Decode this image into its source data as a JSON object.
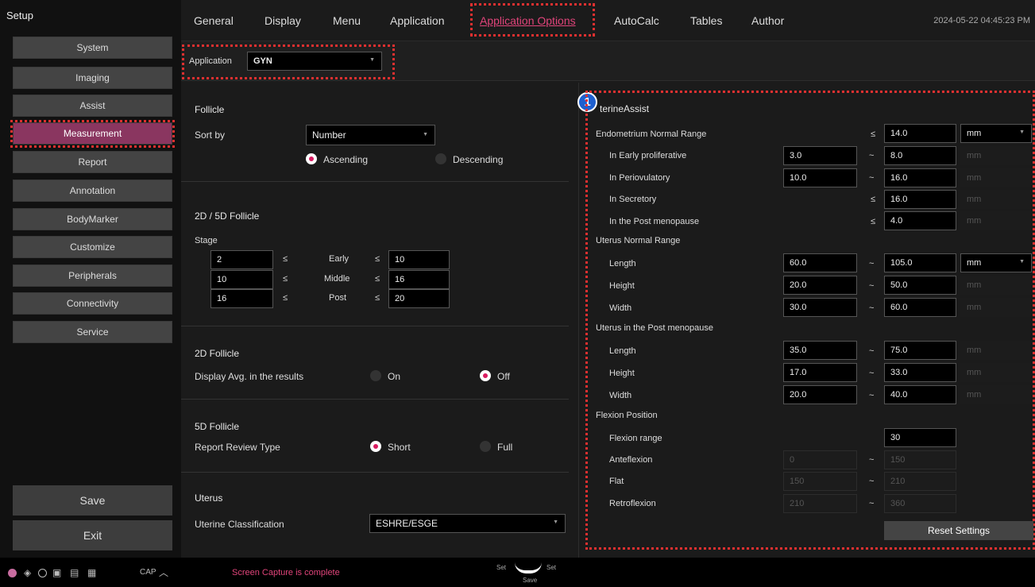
{
  "sidebar": {
    "title": "Setup",
    "items": [
      "System",
      "Imaging",
      "Assist",
      "Measurement",
      "Report",
      "Annotation",
      "BodyMarker",
      "Customize",
      "Peripherals",
      "Connectivity",
      "Service"
    ],
    "save": "Save",
    "exit": "Exit"
  },
  "tabs": [
    "General",
    "Display",
    "Menu",
    "Application",
    "Application Options",
    "AutoCalc",
    "Tables",
    "Author"
  ],
  "datetime": "2024-05-22 04:45:23 PM",
  "appbar": {
    "label": "Application",
    "value": "GYN"
  },
  "follicle": {
    "title": "Follicle",
    "sort_label": "Sort by",
    "sort_value": "Number",
    "asc": "Ascending",
    "desc": "Descending"
  },
  "follicle2d5d": {
    "title": "2D / 5D Follicle",
    "stage": "Stage",
    "rows": [
      {
        "from": "2",
        "name": "Early",
        "to": "10"
      },
      {
        "from": "10",
        "name": "Middle",
        "to": "16"
      },
      {
        "from": "16",
        "name": "Post",
        "to": "20"
      }
    ],
    "le": "≤"
  },
  "follicle2d": {
    "title": "2D Follicle",
    "label": "Display Avg. in the results",
    "on": "On",
    "off": "Off"
  },
  "follicle5d": {
    "title": "5D Follicle",
    "label": "Report Review Type",
    "short": "Short",
    "full": "Full"
  },
  "uterus": {
    "title": "Uterus",
    "label": "Uterine Classification",
    "value": "ESHRE/ESGE"
  },
  "uterine": {
    "title": "terineAssist",
    "badge": "1",
    "endo_title": "Endometrium Normal Range",
    "endo_max": "14.0",
    "unit": "mm",
    "endo_rows": [
      {
        "label": "In Early proliferative",
        "a": "3.0",
        "b": "8.0",
        "sym": "~"
      },
      {
        "label": "In Periovulatory",
        "a": "10.0",
        "b": "16.0",
        "sym": "~"
      },
      {
        "label": "In Secretory",
        "a": "",
        "b": "16.0",
        "sym": "≤"
      },
      {
        "label": "In the Post menopause",
        "a": "",
        "b": "4.0",
        "sym": "≤"
      }
    ],
    "ut_title": "Uterus Normal Range",
    "ut_rows": [
      {
        "label": "Length",
        "a": "60.0",
        "b": "105.0"
      },
      {
        "label": "Height",
        "a": "20.0",
        "b": "50.0"
      },
      {
        "label": "Width",
        "a": "30.0",
        "b": "60.0"
      }
    ],
    "pm_title": "Uterus in the Post menopause",
    "pm_rows": [
      {
        "label": "Length",
        "a": "35.0",
        "b": "75.0"
      },
      {
        "label": "Height",
        "a": "17.0",
        "b": "33.0"
      },
      {
        "label": "Width",
        "a": "20.0",
        "b": "40.0"
      }
    ],
    "flex_title": "Flexion Position",
    "flex_label": "Flexion range",
    "flex_value": "30",
    "flex_rows": [
      {
        "label": "Anteflexion",
        "a": "0",
        "b": "150"
      },
      {
        "label": "Flat",
        "a": "150",
        "b": "210"
      },
      {
        "label": "Retroflexion",
        "a": "210",
        "b": "360"
      }
    ],
    "reset": "Reset Settings",
    "tilde": "~",
    "le": "≤"
  },
  "status": {
    "message": "Screen Capture is complete",
    "cap": "CAP",
    "set1": "Set",
    "set2": "Set",
    "save": "Save"
  }
}
